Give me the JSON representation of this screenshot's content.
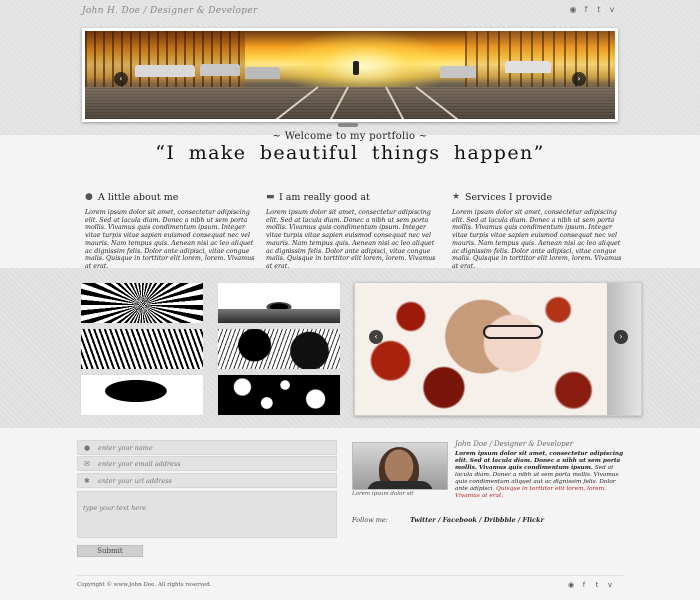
{
  "header": {
    "site_title": "John H. Doe / Designer & Developer",
    "social_icons": [
      "dribbble-icon",
      "facebook-icon",
      "twitter-icon",
      "vimeo-icon"
    ]
  },
  "hero": {
    "prev_arrow": "‹",
    "next_arrow": "›"
  },
  "welcome": {
    "subtitle": "~ Welcome to my portfolio ~",
    "tagline": "“I make beautiful things happen”"
  },
  "columns": [
    {
      "icon": "user-icon",
      "title": "A little about me",
      "text": "Lorem ipsum dolor sit amet, consectetur adipiscing elit. Sed at lacula diam. Donec a nibh ut sem porta mollis. Vivamus quis condimentum ipsum. Integer vitae turpis vitae sapien euismod consequat nec vel mauris. Nam tempus quis. Aenean nisi ac leo aliquet ac dignissim felis. Dolor ante adipisci, vitae congue malis. Quisque in torttitor elit lorem, lorem. Vivamus at erat."
    },
    {
      "icon": "chat-icon",
      "title": "I am really good at",
      "text": "Lorem ipsum dolor sit amet, consectetur adipiscing elit. Sed at lacula diam. Donec a nibh ut sem porta mollis. Vivamus quis condimentum ipsum. Integer vitae turpis vitae sapien euismod consequat nec vel mauris. Nam tempus quis. Aenean nisi ac leo aliquet ac dignissim felis. Dolor ante adipisci, vitae congue malis. Quisque in torttitor elit lorem, lorem. Vivamus at erat."
    },
    {
      "icon": "star-icon",
      "title": "Services I provide",
      "text": "Lorem ipsum dolor sit amet, consectetur adipiscing elit. Sed at lacula diam. Donec a nibh ut sem porta mollis. Vivamus quis condimentum ipsum. Integer vitae turpis vitae sapien euismod consequat nec vel mauris. Nam tempus quis. Aenean nisi ac leo aliquet ac dignissim felis. Dolor ante adipisci, vitae congue malis. Quisque in torttitor elit lorem, lorem. Vivamus at erat."
    }
  ],
  "feature": {
    "prev_arrow": "‹",
    "next_arrow": "›"
  },
  "form": {
    "name_placeholder": "enter your name",
    "email_placeholder": "enter your email address",
    "url_placeholder": "enter your url address",
    "message_placeholder": "type your text here",
    "submit_label": "Submit"
  },
  "about": {
    "title": "John Doe / Designer & Developer",
    "bold_text": "Lorem ipsum dolor sit amet, consectetur adipiscing elit. Sed at lacula diam. Donec a nibh ut sem porta mollis. Vivamus quis condimentum ipsum.",
    "body_text": "Sed at lacula diam. Donec a nibh ut sem porta mollis. Vivamus quis condimentum aliquet aut ac dignissim felis. Dolor ante adipisci.",
    "red_text": "Quisque in torttitor elit lorem, lorem. Vivamus at erat.",
    "caption": "Lorem ipsum dolor sit",
    "follow_label": "Follow me:",
    "follow_links": "Twitter / Facebook / Dribbble / Flickr"
  },
  "footer": {
    "copyright": "Copyright © www.John Doe. All rights reserved.",
    "social_icons": [
      "dribbble-icon",
      "facebook-icon",
      "twitter-icon",
      "vimeo-icon"
    ]
  }
}
